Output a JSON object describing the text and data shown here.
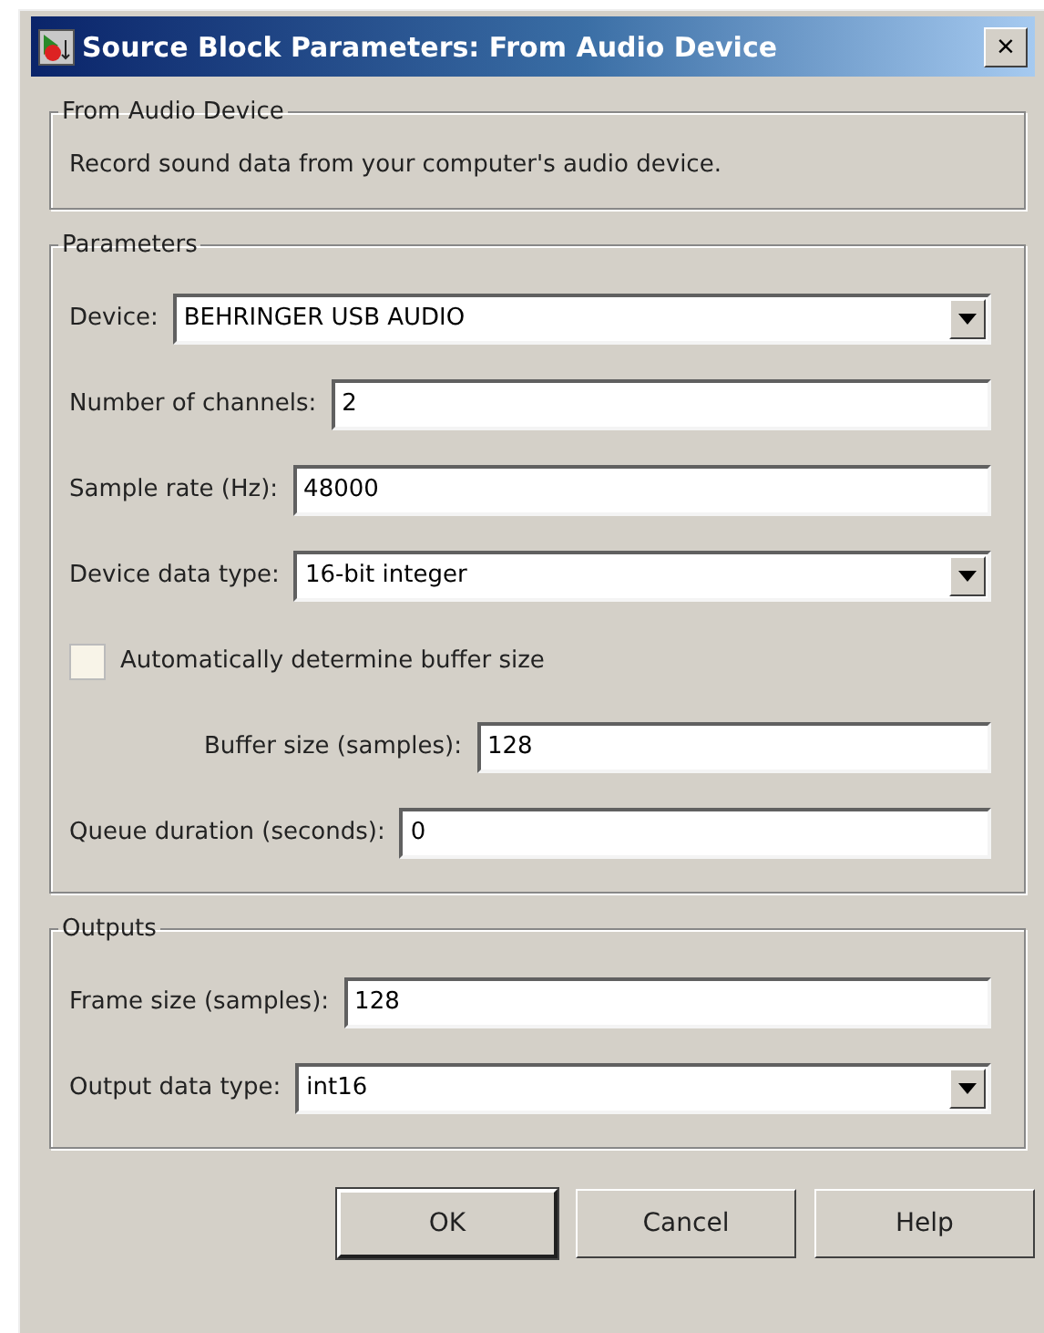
{
  "window": {
    "title": "Source Block Parameters: From Audio Device",
    "close": "×"
  },
  "description_group": {
    "title": "From Audio Device",
    "text": "Record sound data from your computer's audio device."
  },
  "parameters_group": {
    "title": "Parameters",
    "fields": [
      {
        "kind": "dropdown",
        "label": "Device:",
        "value": "BEHRINGER USB AUDIO"
      },
      {
        "kind": "text",
        "label": "Number of channels:",
        "value": "2"
      },
      {
        "kind": "text",
        "label": "Sample rate (Hz):",
        "value": "48000"
      },
      {
        "kind": "dropdown",
        "label": "Device data type:",
        "value": "16-bit integer"
      },
      {
        "kind": "checkbox",
        "label": "Automatically determine buffer size",
        "checked": false
      },
      {
        "kind": "subtext",
        "label": "Buffer size (samples):",
        "value": "128"
      },
      {
        "kind": "text",
        "label": "Queue duration (seconds):",
        "value": "0"
      }
    ]
  },
  "outputs_group": {
    "title": "Outputs",
    "fields": [
      {
        "kind": "text",
        "label": "Frame size (samples):",
        "value": "128"
      },
      {
        "kind": "dropdown",
        "label": "Output data type:",
        "value": "int16"
      }
    ]
  },
  "buttons": [
    {
      "label": "OK",
      "default": true
    },
    {
      "label": "Cancel",
      "default": false
    },
    {
      "label": "Help",
      "default": false
    }
  ]
}
